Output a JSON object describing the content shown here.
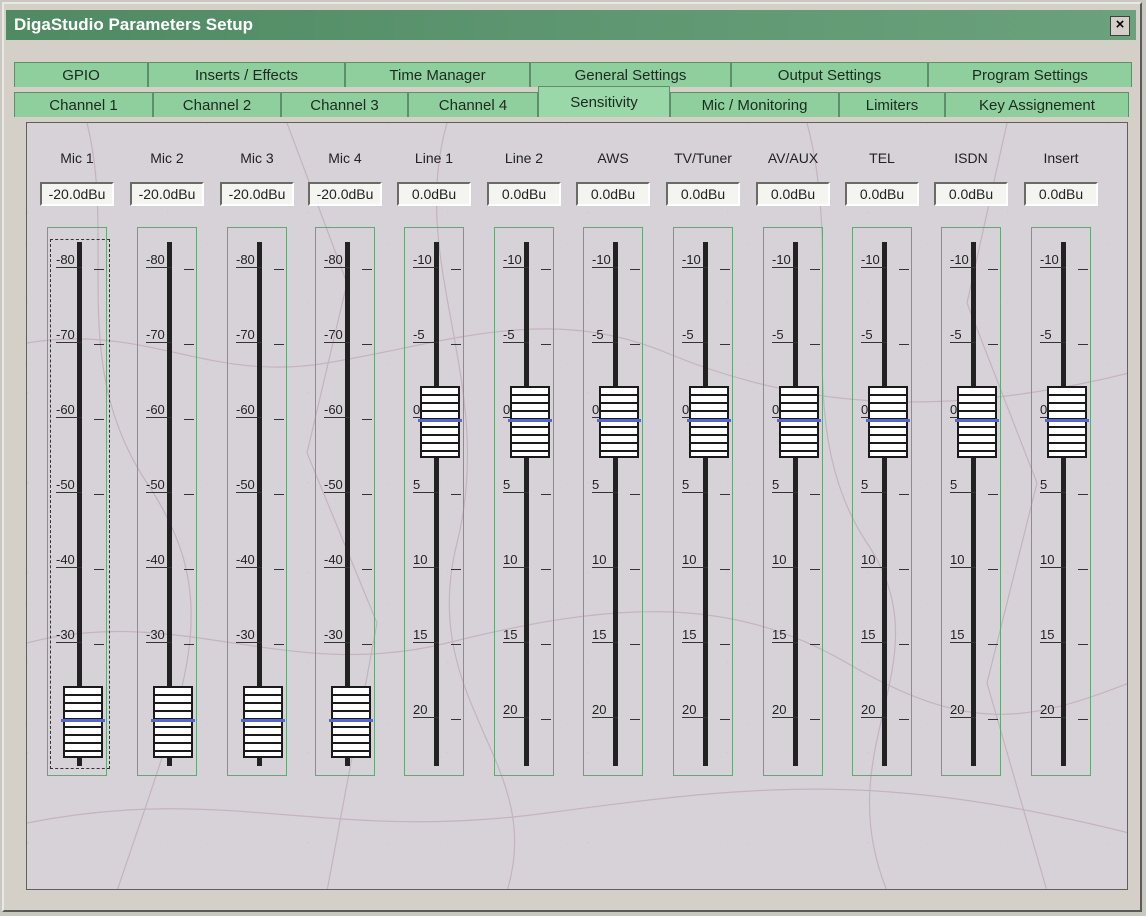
{
  "window": {
    "title": "DigaStudio Parameters Setup",
    "close_label": "×"
  },
  "tabs_row1": [
    "GPIO",
    "Inserts / Effects",
    "Time Manager",
    "General Settings",
    "Output Settings",
    "Program Settings"
  ],
  "tabs_row2": [
    "Channel 1",
    "Channel 2",
    "Channel 3",
    "Channel 4",
    "Sensitivity",
    "Mic / Monitoring",
    "Limiters",
    "Key Assignement"
  ],
  "active_tab": "Sensitivity",
  "mic_scale": [
    "-80",
    "-70",
    "-60",
    "-50",
    "-40",
    "-30"
  ],
  "line_scale": [
    "-10",
    "-5",
    "0",
    "5",
    "10",
    "15",
    "20"
  ],
  "channels": [
    {
      "label": "Mic 1",
      "value": "-20.0dBu",
      "type": "mic",
      "level": -20
    },
    {
      "label": "Mic 2",
      "value": "-20.0dBu",
      "type": "mic",
      "level": -20
    },
    {
      "label": "Mic 3",
      "value": "-20.0dBu",
      "type": "mic",
      "level": -20
    },
    {
      "label": "Mic 4",
      "value": "-20.0dBu",
      "type": "mic",
      "level": -20
    },
    {
      "label": "Line 1",
      "value": "0.0dBu",
      "type": "line",
      "level": 0
    },
    {
      "label": "Line 2",
      "value": "0.0dBu",
      "type": "line",
      "level": 0
    },
    {
      "label": "AWS",
      "value": "0.0dBu",
      "type": "line",
      "level": 0
    },
    {
      "label": "TV/Tuner",
      "value": "0.0dBu",
      "type": "line",
      "level": 0
    },
    {
      "label": "AV/AUX",
      "value": "0.0dBu",
      "type": "line",
      "level": 0
    },
    {
      "label": "TEL",
      "value": "0.0dBu",
      "type": "line",
      "level": 0
    },
    {
      "label": "ISDN",
      "value": "0.0dBu",
      "type": "line",
      "level": 0
    },
    {
      "label": "Insert",
      "value": "0.0dBu",
      "type": "line",
      "level": 0
    }
  ],
  "colors": {
    "title_bar": "#4f8a63",
    "tab": "#8fcf9e",
    "thumb_marker": "#5566cc"
  }
}
